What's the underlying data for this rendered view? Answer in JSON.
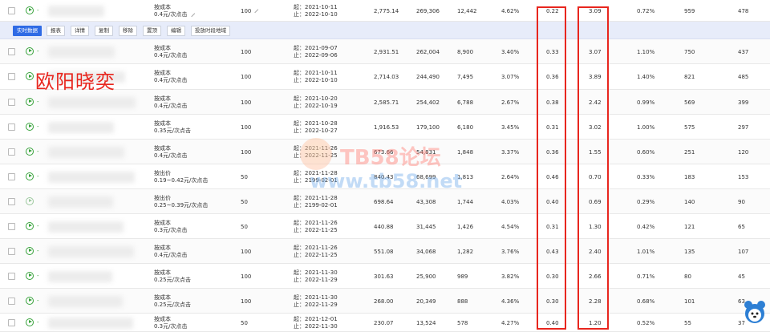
{
  "toolbar": {
    "buttons": [
      "实时数据",
      "报表",
      "详情",
      "复制",
      "移除",
      "置顶",
      "编辑",
      "投放时段地域"
    ]
  },
  "rows": [
    {
      "bid_type": "按成本",
      "bid_price": "0.4元/次点击",
      "budget": "100",
      "start": "起：2021-10-11",
      "end": "止：2022-10-10",
      "cost": "2,775.14",
      "impressions": "269,306",
      "clicks": "12,442",
      "ctr": "4.62%",
      "ppc": "0.22",
      "roi": "3.09",
      "conv": "0.72%",
      "fav": "959",
      "cart": "478",
      "play_grey": false
    },
    {
      "bid_type": "按成本",
      "bid_price": "0.4元/次点击",
      "budget": "100",
      "start": "起：2021-09-07",
      "end": "止：2022-09-06",
      "cost": "2,931.51",
      "impressions": "262,004",
      "clicks": "8,900",
      "ctr": "3.40%",
      "ppc": "0.33",
      "roi": "3.07",
      "conv": "1.10%",
      "fav": "750",
      "cart": "437",
      "play_grey": false
    },
    {
      "bid_type": "按成本",
      "bid_price": "0.4元/次点击",
      "budget": "100",
      "start": "起：2021-10-11",
      "end": "止：2022-10-10",
      "cost": "2,714.03",
      "impressions": "244,490",
      "clicks": "7,495",
      "ctr": "3.07%",
      "ppc": "0.36",
      "roi": "3.89",
      "conv": "1.40%",
      "fav": "821",
      "cart": "485",
      "play_grey": false
    },
    {
      "bid_type": "按成本",
      "bid_price": "0.4元/次点击",
      "budget": "100",
      "start": "起：2021-10-20",
      "end": "止：2022-10-19",
      "cost": "2,585.71",
      "impressions": "254,402",
      "clicks": "6,788",
      "ctr": "2.67%",
      "ppc": "0.38",
      "roi": "2.42",
      "conv": "0.99%",
      "fav": "569",
      "cart": "399",
      "play_grey": false
    },
    {
      "bid_type": "按成本",
      "bid_price": "0.35元/次点击",
      "budget": "100",
      "start": "起：2021-10-28",
      "end": "止：2022-10-27",
      "cost": "1,916.53",
      "impressions": "179,100",
      "clicks": "6,180",
      "ctr": "3.45%",
      "ppc": "0.31",
      "roi": "3.02",
      "conv": "1.00%",
      "fav": "575",
      "cart": "297",
      "play_grey": false
    },
    {
      "bid_type": "按成本",
      "bid_price": "0.4元/次点击",
      "budget": "100",
      "start": "起：2021-11-26",
      "end": "止：2022-11-25",
      "cost": "673.66",
      "impressions": "54,831",
      "clicks": "1,848",
      "ctr": "3.37%",
      "ppc": "0.36",
      "roi": "1.55",
      "conv": "0.60%",
      "fav": "251",
      "cart": "120",
      "play_grey": false
    },
    {
      "bid_type": "按出价",
      "bid_price": "0.19~0.42元/次点击",
      "budget": "50",
      "start": "起：2021-11-28",
      "end": "止：2199-02-01",
      "cost": "840.43",
      "impressions": "68,699",
      "clicks": "1,813",
      "ctr": "2.64%",
      "ppc": "0.46",
      "roi": "0.70",
      "conv": "0.33%",
      "fav": "183",
      "cart": "153",
      "play_grey": false
    },
    {
      "bid_type": "按出价",
      "bid_price": "0.25~0.39元/次点击",
      "budget": "50",
      "start": "起：2021-11-28",
      "end": "止：2199-02-01",
      "cost": "698.64",
      "impressions": "43,308",
      "clicks": "1,744",
      "ctr": "4.03%",
      "ppc": "0.40",
      "roi": "0.69",
      "conv": "0.29%",
      "fav": "140",
      "cart": "90",
      "play_grey": true
    },
    {
      "bid_type": "按成本",
      "bid_price": "0.3元/次点击",
      "budget": "50",
      "start": "起：2021-11-26",
      "end": "止：2022-11-25",
      "cost": "440.88",
      "impressions": "31,445",
      "clicks": "1,426",
      "ctr": "4.54%",
      "ppc": "0.31",
      "roi": "1.30",
      "conv": "0.42%",
      "fav": "121",
      "cart": "65",
      "play_grey": false
    },
    {
      "bid_type": "按成本",
      "bid_price": "0.4元/次点击",
      "budget": "100",
      "start": "起：2021-11-26",
      "end": "止：2022-11-25",
      "cost": "551.08",
      "impressions": "34,068",
      "clicks": "1,282",
      "ctr": "3.76%",
      "ppc": "0.43",
      "roi": "2.40",
      "conv": "1.01%",
      "fav": "135",
      "cart": "107",
      "play_grey": false
    },
    {
      "bid_type": "按成本",
      "bid_price": "0.25元/次点击",
      "budget": "100",
      "start": "起：2021-11-30",
      "end": "止：2022-11-29",
      "cost": "301.63",
      "impressions": "25,900",
      "clicks": "989",
      "ctr": "3.82%",
      "ppc": "0.30",
      "roi": "2.66",
      "conv": "0.71%",
      "fav": "80",
      "cart": "45",
      "play_grey": false
    },
    {
      "bid_type": "按成本",
      "bid_price": "0.25元/次点击",
      "budget": "100",
      "start": "起：2021-11-30",
      "end": "止：2022-11-29",
      "cost": "268.00",
      "impressions": "20,349",
      "clicks": "888",
      "ctr": "4.36%",
      "ppc": "0.30",
      "roi": "2.28",
      "conv": "0.68%",
      "fav": "101",
      "cart": "63",
      "play_grey": false
    },
    {
      "bid_type": "按成本",
      "bid_price": "0.3元/次点击",
      "budget": "50",
      "start": "起：2021-12-01",
      "end": "止：2022-11-30",
      "cost": "230.07",
      "impressions": "13,524",
      "clicks": "578",
      "ctr": "4.27%",
      "ppc": "0.40",
      "roi": "1.20",
      "conv": "0.52%",
      "fav": "55",
      "cart": "37",
      "play_grey": false
    }
  ],
  "watermarks": {
    "author": "欧阳晓奕",
    "brand": "TB58论坛",
    "url": "www.tb58.net"
  },
  "colors": {
    "accent": "#2f6be5",
    "play_green": "#36a23a",
    "highlight_red": "#e8261e",
    "toolbar_bg": "#e7ecfa"
  },
  "icons": {
    "play": "play-circle-icon",
    "edit": "pencil-icon",
    "checkbox": "checkbox-icon",
    "mascot": "mascot-icon"
  }
}
